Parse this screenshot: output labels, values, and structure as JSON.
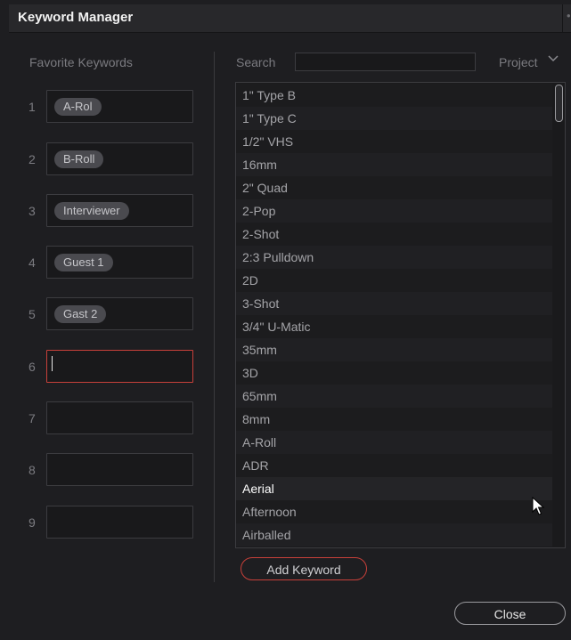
{
  "window": {
    "title": "Keyword Manager",
    "menu_glyph": "••"
  },
  "favorites": {
    "heading": "Favorite Keywords",
    "slots": [
      {
        "num": "1",
        "tag": "A-Rol"
      },
      {
        "num": "2",
        "tag": "B-Roll"
      },
      {
        "num": "3",
        "tag": "Interviewer"
      },
      {
        "num": "4",
        "tag": "Guest 1"
      },
      {
        "num": "5",
        "tag": "Gast 2"
      },
      {
        "num": "6",
        "tag": ""
      },
      {
        "num": "7",
        "tag": ""
      },
      {
        "num": "8",
        "tag": ""
      },
      {
        "num": "9",
        "tag": ""
      }
    ]
  },
  "search": {
    "label": "Search",
    "value": ""
  },
  "scope": {
    "label": "Project",
    "icon": "chevron-down-icon"
  },
  "keywords": [
    "1\" Type B",
    "1\" Type C",
    "1/2\" VHS",
    "16mm",
    "2\" Quad",
    "2-Pop",
    "2-Shot",
    "2:3 Pulldown",
    "2D",
    "3-Shot",
    "3/4\" U-Matic",
    "35mm",
    "3D",
    "65mm",
    "8mm",
    "A-Roll",
    "ADR",
    "Aerial",
    "Afternoon",
    "Airballed"
  ],
  "hovered_keyword": "Aerial",
  "buttons": {
    "add_keyword": "Add Keyword",
    "close": "Close"
  },
  "colors": {
    "accent": "#c8403a",
    "background": "#1e1e21"
  }
}
